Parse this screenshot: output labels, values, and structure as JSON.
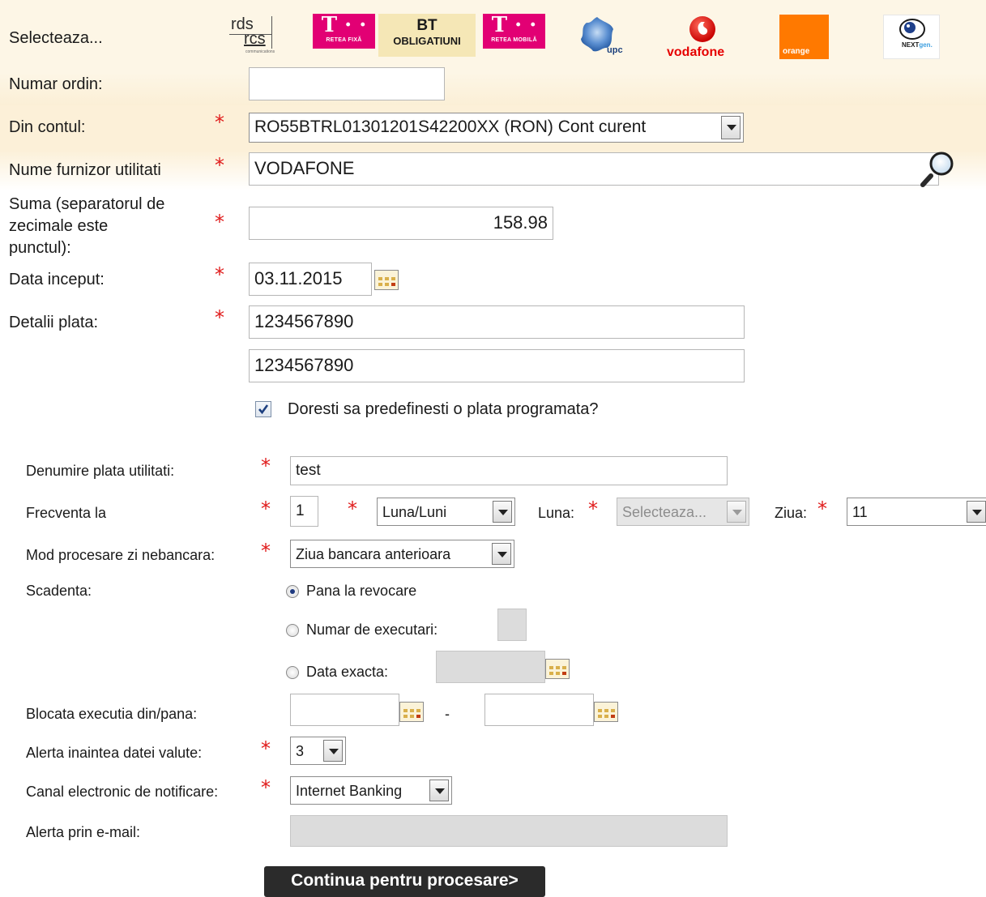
{
  "header": {
    "select_label": "Selecteaza...",
    "logos": {
      "rds_top": "rds",
      "rds_bottom": "rcs",
      "rds_sub": "communications",
      "telekom_fix_sub": "RETEA FIXĂ",
      "bt_top": "BT",
      "bt_bottom": "OBLIGATIUNI",
      "telekom_mobil_sub": "RETEA MOBILĂ",
      "upc": "upc",
      "vodafone": "vodafone",
      "orange": "orange",
      "nextgen": "NEXT",
      "nextgen_suffix": "gen."
    }
  },
  "form": {
    "order": {
      "label": "Numar ordin:",
      "value": ""
    },
    "account": {
      "label": "Din contul:",
      "value": "RO55BTRL01301201S42200XX (RON) Cont curent"
    },
    "provider": {
      "label": "Nume furnizor utilitati",
      "value": "VODAFONE"
    },
    "amount": {
      "label_l1": "Suma (separatorul de",
      "label_l2": "zecimale este",
      "label_l3": "punctul):",
      "value": "158.98"
    },
    "start_date": {
      "label": "Data inceput:",
      "value": "03.11.2015"
    },
    "details": {
      "label": "Detalii plata:",
      "line1": "1234567890",
      "line2": "1234567890"
    },
    "predefine": {
      "label": "Doresti sa predefinesti o plata programata?",
      "checked": true
    }
  },
  "schedule": {
    "name": {
      "label": "Denumire plata utilitati:",
      "value": "test"
    },
    "frequency": {
      "label": "Frecventa la",
      "count": "1",
      "unit": "Luna/Luni",
      "month_label": "Luna:",
      "month_value": "Selecteaza...",
      "day_label": "Ziua:",
      "day_value": "11"
    },
    "processing": {
      "label": "Mod procesare zi nebancara:",
      "value": "Ziua bancara anterioara"
    },
    "due": {
      "label": "Scadenta:",
      "options": [
        "Pana la revocare",
        "Numar de executari:",
        "Data exacta:"
      ],
      "selected": "Pana la revocare",
      "executions_value": "",
      "exact_date_value": ""
    },
    "blocked": {
      "label": "Blocata executia din/pana:",
      "from": "",
      "separator": "-",
      "to": ""
    },
    "alert_before": {
      "label": "Alerta inaintea datei valute:",
      "value": "3"
    },
    "channel": {
      "label": "Canal electronic de notificare:",
      "value": "Internet Banking"
    },
    "email_alert": {
      "label": "Alerta prin e-mail:",
      "value": ""
    }
  },
  "actions": {
    "continue_label": "Continua pentru procesare>"
  },
  "colors": {
    "required_star": "#e01b1b",
    "header_band": "#fdf6e6",
    "button_bg": "#2b2b2b",
    "disabled_field": "#dcdcdc",
    "telekom_magenta": "#e20074",
    "vodafone_red": "#e60000",
    "orange_brand": "#ff7900"
  }
}
